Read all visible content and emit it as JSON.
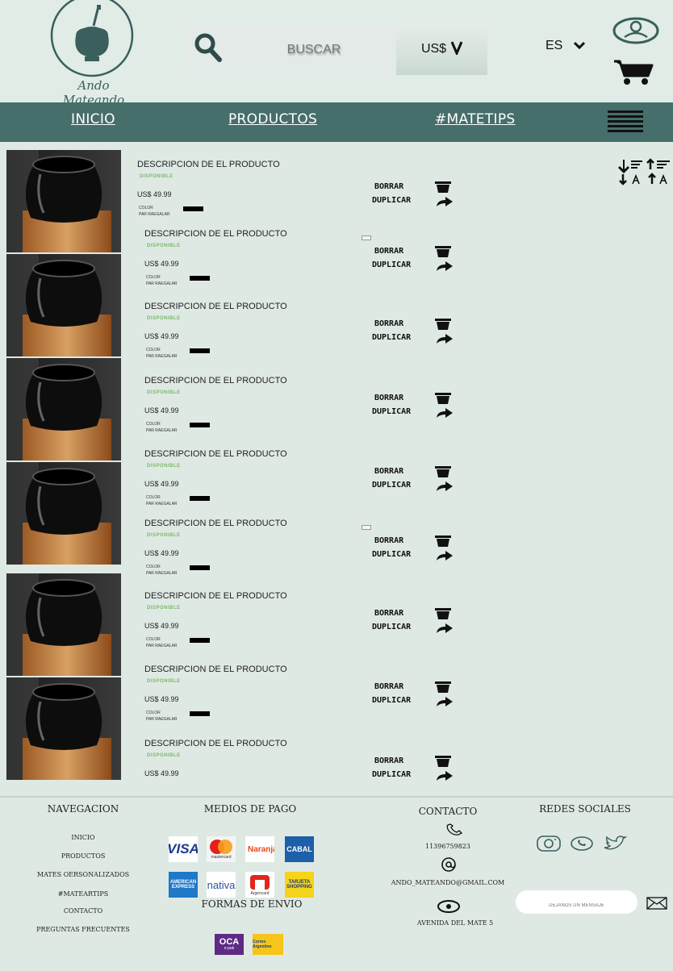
{
  "brand": {
    "logo_text": "Ando Mateando"
  },
  "header": {
    "search_placeholder": "BUSCAR",
    "currency": "US$",
    "language": "ES"
  },
  "nav": {
    "inicio": "INICIO",
    "productos": "PRODUCTOS",
    "matetips": "#MATETIPS"
  },
  "colors": {
    "primary": "#466e6b",
    "background": "#dfe9e4",
    "available": "#7bb86a"
  },
  "cart": {
    "items": [
      {
        "description": "DESCRIPCION DE EL PRODUCTO",
        "status": "DISPONIBLE",
        "price": "US$ 49.99",
        "color_label": "COLOR",
        "gift_label": "PAR RAEGALAR",
        "delete": "BORRAR",
        "duplicate": "DUPLICAR"
      },
      {
        "description": "DESCRIPCION DE EL PRODUCTO",
        "status": "DISPONIBLE",
        "price": "US$ 49.99",
        "color_label": "COLOR",
        "gift_label": "PAR RAEGALAR",
        "delete": "BORRAR",
        "duplicate": "DUPLICAR"
      },
      {
        "description": "DESCRIPCION DE EL PRODUCTO",
        "status": "DISPONIBLE",
        "price": "US$ 49.99",
        "color_label": "COLOR",
        "gift_label": "PAR RAEGALAR",
        "delete": "BORRAR",
        "duplicate": "DUPLICAR"
      },
      {
        "description": "DESCRIPCION DE EL PRODUCTO",
        "status": "DISPONIBLE",
        "price": "US$ 49.99",
        "color_label": "COLOR",
        "gift_label": "PAR RAEGALAR",
        "delete": "BORRAR",
        "duplicate": "DUPLICAR"
      },
      {
        "description": "DESCRIPCION DE EL PRODUCTO",
        "status": "DISPONIBLE",
        "price": "US$ 49.99",
        "color_label": "COLOR",
        "gift_label": "PAR RAEGALAR",
        "delete": "BORRAR",
        "duplicate": "DUPLICAR"
      },
      {
        "description": "DESCRIPCION DE EL PRODUCTO",
        "status": "DISPONIBLE",
        "price": "US$ 49.99",
        "color_label": "COLOR",
        "gift_label": "PAR RAEGALAR",
        "delete": "BORRAR",
        "duplicate": "DUPLICAR"
      },
      {
        "description": "DESCRIPCION DE EL PRODUCTO",
        "status": "DISPONIBLE",
        "price": "US$ 49.99",
        "color_label": "COLOR",
        "gift_label": "PAR RAEGALAR",
        "delete": "BORRAR",
        "duplicate": "DUPLICAR"
      },
      {
        "description": "DESCRIPCION DE EL PRODUCTO",
        "status": "DISPONIBLE",
        "price": "US$ 49.99",
        "color_label": "COLOR",
        "gift_label": "PAR RAEGALAR",
        "delete": "BORRAR",
        "duplicate": "DUPLICAR"
      },
      {
        "description": "DESCRIPCION DE EL PRODUCTO",
        "status": "DISPONIBLE",
        "price": "US$ 49.99",
        "delete": "BORRAR",
        "duplicate": "DUPLICAR"
      }
    ]
  },
  "footer": {
    "navegacion": {
      "title": "NAVEGACION",
      "links": [
        "INICIO",
        "PRODUCTOS",
        "MATES OERSONALIZADOS",
        "#MATEARTIPS",
        "CONTACTO",
        "PREGUNTAS FRECUENTES"
      ]
    },
    "pagos": {
      "title": "MEDIOS DE PAGO",
      "methods": [
        "VISA",
        "mastercard",
        "Naranja",
        "CABAL",
        "AMERICAN EXPRESS",
        "nativa",
        "Argencard",
        "TARJETA SHOPPING"
      ]
    },
    "envio": {
      "title": "FORMAS DE ENVIO",
      "carriers": [
        "OCA",
        "e-pak",
        "Correo Argentino"
      ]
    },
    "contacto": {
      "title": "CONTACTO",
      "phone": "11396759823",
      "email": "ANDO_MATEANDO@GMAIL.COM",
      "address": "AVENIDA DEL MATE 5"
    },
    "redes": {
      "title": "REDES SOCIALES",
      "message_placeholder": "DEJANOS UN MENSAJE"
    }
  }
}
